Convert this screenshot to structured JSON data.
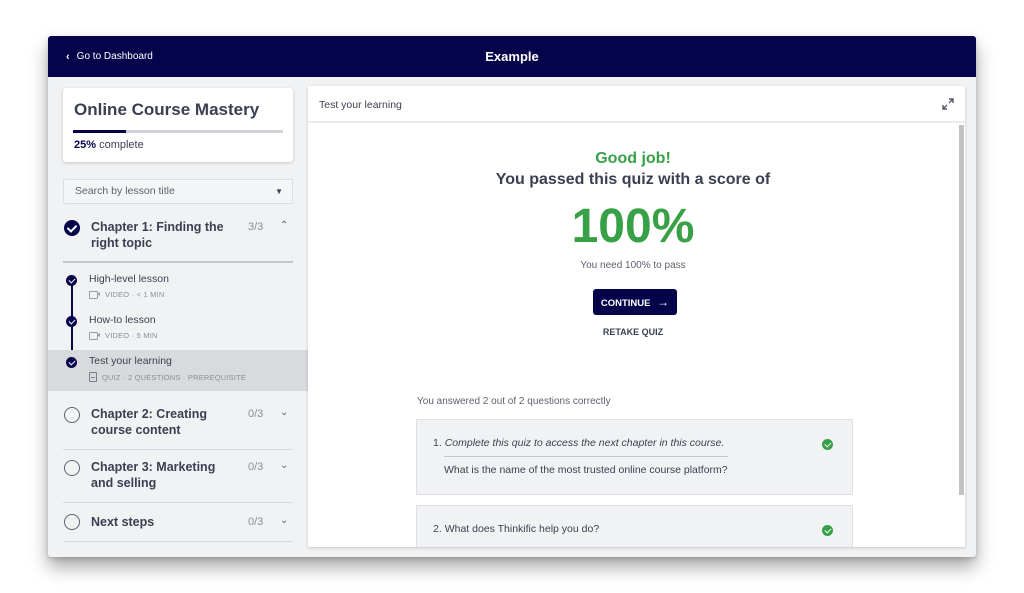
{
  "topbar": {
    "back_label": "Go to Dashboard",
    "title": "Example"
  },
  "course": {
    "title": "Online Course Mastery",
    "progress_percent": 25,
    "progress_value": "25%",
    "progress_suffix": "complete"
  },
  "search": {
    "placeholder": "Search by lesson title"
  },
  "chapters": [
    {
      "title": "Chapter 1: Finding the right topic",
      "count": "3/3",
      "status": "complete",
      "expanded": true,
      "lessons": [
        {
          "title": "High-level lesson",
          "meta": "VIDEO · < 1 MIN",
          "type_icon": "video-icon",
          "status": "complete"
        },
        {
          "title": "How-to lesson",
          "meta": "VIDEO · 5 MIN",
          "type_icon": "video-icon",
          "status": "complete"
        },
        {
          "title": "Test your learning",
          "meta": "QUIZ · 2 QUESTIONS · PREREQUISITE",
          "type_icon": "quiz-icon",
          "status": "complete",
          "active": true
        }
      ]
    },
    {
      "title": "Chapter 2: Creating course content",
      "count": "0/3",
      "status": "incomplete",
      "expanded": false
    },
    {
      "title": "Chapter 3: Marketing and selling",
      "count": "0/3",
      "status": "incomplete",
      "expanded": false
    },
    {
      "title": "Next steps",
      "count": "0/3",
      "status": "incomplete",
      "expanded": false
    }
  ],
  "main": {
    "header_title": "Test your learning",
    "result": {
      "headline": "Good job!",
      "message": "You passed this quiz with a score of",
      "score": "100%",
      "pass_requirement": "You need 100% to pass",
      "continue_label": "CONTINUE",
      "continue_arrow": "→",
      "retake_label": "RETAKE QUIZ"
    },
    "summary": "You answered 2 out of 2 questions correctly",
    "questions": [
      {
        "number": "1.",
        "text": "Complete this quiz to access the next chapter in this course.",
        "sub_text": "What is the name of the most trusted online course platform?",
        "correct": true
      },
      {
        "number": "2.",
        "text": "What does Thinkific help you do?",
        "correct": true
      }
    ]
  },
  "colors": {
    "brand_navy": "#05044b",
    "success_green": "#38a047"
  }
}
